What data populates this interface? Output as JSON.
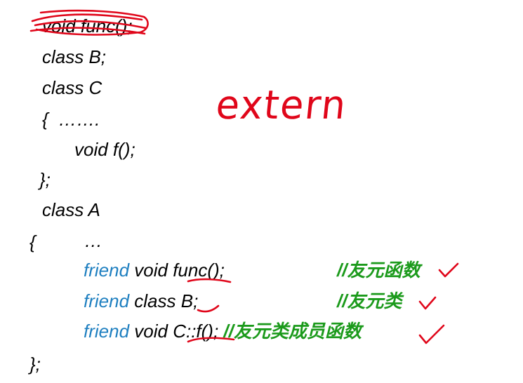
{
  "lines": {
    "l1_code": "void func()",
    "l1_semi": ";",
    "l2": "class B;",
    "l3": "class C",
    "l4": "{  …….",
    "l5": "void f();",
    "l6": "};",
    "l7": "class A",
    "l8_brace": "{",
    "l8_dots": "…",
    "l9_kw": "friend",
    "l9_rest": " void ",
    "l9_name": "func",
    "l9_end": "();",
    "l9_comment": "//友元函数",
    "l10_kw": "friend",
    "l10_rest": " class ",
    "l10_name": "B;",
    "l10_comment": "//友元类",
    "l11_kw": "friend",
    "l11_rest": " void ",
    "l11_name": "C::f()",
    "l11_end": "; ",
    "l11_comment": "//友元类成员函数",
    "l12": "};"
  },
  "handwriting": "extern",
  "colors": {
    "keyword": "#1e7fc0",
    "comment": "#1b9a1b",
    "ink": "#e0061a",
    "text": "#000000"
  }
}
